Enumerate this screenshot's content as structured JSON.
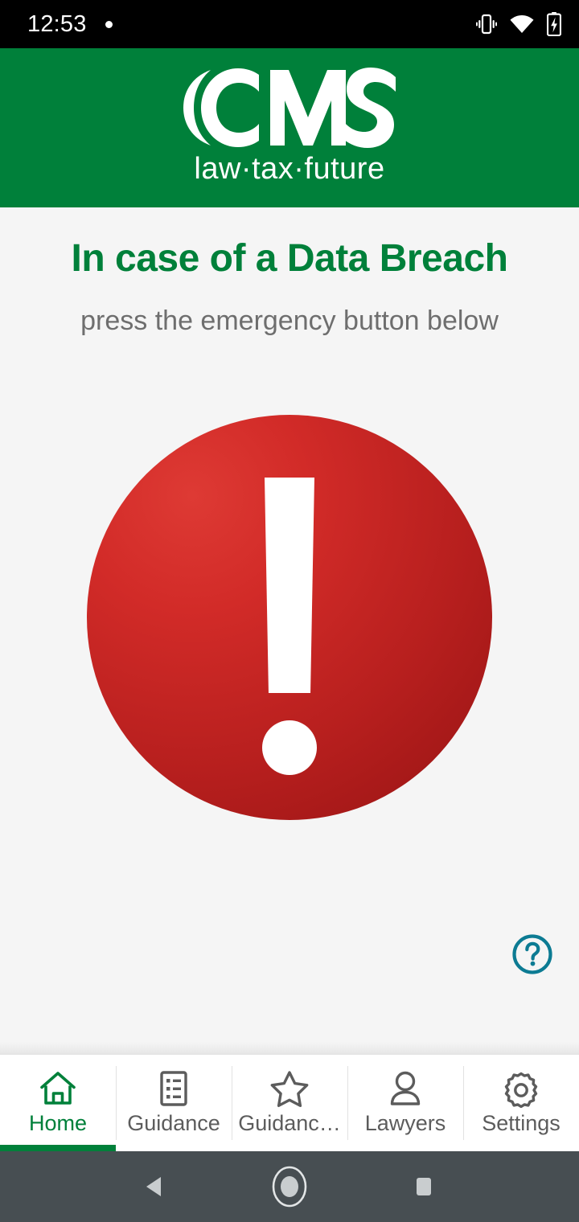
{
  "status_bar": {
    "time": "12:53",
    "notification_dot": "•",
    "icons": [
      "vibrate-icon",
      "wifi-icon",
      "battery-charging-icon"
    ]
  },
  "brand_header": {
    "logo_text": "CMS",
    "tagline": "law·tax·future",
    "background_color": "#00803A"
  },
  "main": {
    "headline": "In case of a Data Breach",
    "headline_color": "#00803A",
    "subheadline": "press the emergency button below",
    "subheadline_color": "#6E6E6E",
    "emergency_button": {
      "name": "emergency-button",
      "symbol": "!",
      "color_light": "#DE3A34",
      "color_dark": "#961313"
    },
    "help_button": {
      "name": "help-button",
      "symbol": "?",
      "color": "#0C7B93"
    },
    "background_color": "#F5F5F5"
  },
  "tab_bar": {
    "active_index": 0,
    "active_color": "#00803A",
    "inactive_color": "#5C5C5C",
    "items": [
      {
        "label": "Home",
        "icon": "home-icon"
      },
      {
        "label": "Guidance",
        "icon": "document-list-icon"
      },
      {
        "label": "Guidanc…",
        "icon": "star-icon"
      },
      {
        "label": "Lawyers",
        "icon": "person-icon"
      },
      {
        "label": "Settings",
        "icon": "gear-icon"
      }
    ]
  },
  "system_nav": {
    "background_color": "#474E52",
    "buttons": [
      {
        "name": "back-button",
        "icon": "triangle-left-icon"
      },
      {
        "name": "home-button",
        "icon": "circle-icon"
      },
      {
        "name": "recents-button",
        "icon": "square-icon"
      }
    ]
  }
}
